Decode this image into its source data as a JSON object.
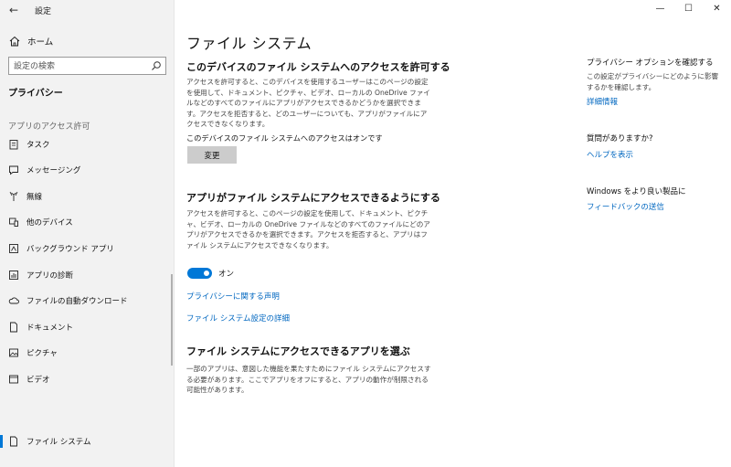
{
  "window": {
    "title": "設定",
    "back_glyph": "←",
    "minimize_glyph": "—",
    "maximize_glyph": "☐",
    "close_glyph": "✕"
  },
  "sidebar": {
    "home_label": "ホーム",
    "search_placeholder": "設定の検索",
    "section_title": "プライバシー",
    "group_label": "アプリのアクセス許可",
    "items": [
      {
        "label": "タスク",
        "icon": "tasks-icon"
      },
      {
        "label": "メッセージング",
        "icon": "message-icon"
      },
      {
        "label": "無線",
        "icon": "radio-icon"
      },
      {
        "label": "他のデバイス",
        "icon": "devices-icon"
      },
      {
        "label": "バックグラウンド アプリ",
        "icon": "background-apps-icon"
      },
      {
        "label": "アプリの診断",
        "icon": "diagnostics-icon"
      },
      {
        "label": "ファイルの自動ダウンロード",
        "icon": "cloud-icon"
      },
      {
        "label": "ドキュメント",
        "icon": "document-icon"
      },
      {
        "label": "ピクチャ",
        "icon": "picture-icon"
      },
      {
        "label": "ビデオ",
        "icon": "video-icon"
      },
      {
        "label": "ファイル システム",
        "icon": "file-system-icon",
        "active": true
      }
    ]
  },
  "main": {
    "title": "ファイル システム",
    "device_access": {
      "heading": "このデバイスのファイル システムへのアクセスを許可する",
      "description": "アクセスを許可すると、このデバイスを使用するユーザーはこのページの設定を使用して、ドキュメント、ピクチャ、ビデオ、ローカルの OneDrive ファイルなどのすべてのファイルにアプリがアクセスできるかどうかを選択できます。アクセスを拒否すると、どのユーザーについても、アプリがファイルにアクセスできなくなります。",
      "status": "このデバイスのファイル システムへのアクセスはオンです",
      "change_button": "変更"
    },
    "app_access": {
      "heading": "アプリがファイル システムにアクセスできるようにする",
      "description": "アクセスを許可すると、このページの設定を使用して、ドキュメント、ピクチャ、ビデオ、ローカルの OneDrive ファイルなどのすべてのファイルにどのアプリがアクセスできるかを選択できます。アクセスを拒否すると、アプリはファイル システムにアクセスできなくなります。",
      "toggle_state": "オン",
      "toggle_on": true
    },
    "links": {
      "privacy_statement": "プライバシーに関する声明",
      "file_system_details": "ファイル システム設定の詳細"
    },
    "choose_apps": {
      "heading": "ファイル システムにアクセスできるアプリを選ぶ",
      "description": "一部のアプリは、意図した機能を果たすためにファイル システムにアクセスする必要があります。ここでアプリをオフにすると、アプリの動作が制限される可能性があります。"
    }
  },
  "right_panel": {
    "privacy_heading": "プライバシー オプションを確認する",
    "privacy_text": "この設定がプライバシーにどのように影響するかを確認します。",
    "privacy_link": "詳細情報",
    "question_heading": "質問がありますか?",
    "question_link": "ヘルプを表示",
    "feedback_heading": "Windows をより良い製品に",
    "feedback_link": "フィードバックの送信"
  },
  "colors": {
    "accent": "#0078d7",
    "link": "#0067c0",
    "sidebar_bg": "#f2f2f2"
  }
}
